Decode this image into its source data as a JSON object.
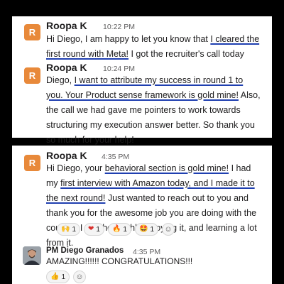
{
  "messages_top": [
    {
      "avatar_letter": "R",
      "author": "Roopa K",
      "time": "10:22 PM",
      "segments": [
        {
          "t": "Hi Diego, I am happy to let you know that ",
          "hl": false
        },
        {
          "t": "I cleared the first round with Meta!",
          "hl": true
        },
        {
          "t": " I got the recruiter's call today",
          "hl": false
        }
      ]
    },
    {
      "avatar_letter": "R",
      "author": "Roopa K",
      "time": "10:24 PM",
      "segments": [
        {
          "t": "Diego, ",
          "hl": false
        },
        {
          "t": "I want to attribute my success in round 1 to you. Your Product sense framework is gold mine!",
          "hl": true
        },
        {
          "t": " Also, the call we had gave me pointers to work towards structuring my execution answer better. So thank you so much for your help!",
          "hl": false
        }
      ]
    }
  ],
  "messages_bottom": [
    {
      "avatar_letter": "R",
      "author": "Roopa K",
      "time": "4:35 PM",
      "segments": [
        {
          "t": "Hi Diego, your ",
          "hl": false
        },
        {
          "t": "behavioral section is gold mine!",
          "hl": true
        },
        {
          "t": " I had my ",
          "hl": false
        },
        {
          "t": "first interview with Amazon today, and I made it to the next round!",
          "hl": true
        },
        {
          "t": " Just wanted to reach out to you and thank you for the awesome job you are doing with the course.. I am thoroughly enjoying it, and learning a lot from it.",
          "hl": false
        }
      ],
      "reactions": [
        {
          "icon": "raised-hands-icon",
          "glyph": "🙌",
          "count": "1"
        },
        {
          "icon": "heart-icon",
          "glyph": "❤",
          "count": "1"
        },
        {
          "icon": "fire-icon",
          "glyph": "🔥",
          "count": "1"
        },
        {
          "icon": "star-struck-icon",
          "glyph": "🤩",
          "count": "1"
        }
      ]
    },
    {
      "author": "PM Diego Granados",
      "time": "4:35 PM",
      "text": "AMAZING!!!!!! CONGRATULATIONS!!!",
      "reactions": [
        {
          "icon": "thumbs-up-icon",
          "glyph": "👍",
          "count": "1"
        }
      ]
    }
  ],
  "colors": {
    "avatar": "#e8893a",
    "highlight_underline": "#1f3fb0"
  }
}
